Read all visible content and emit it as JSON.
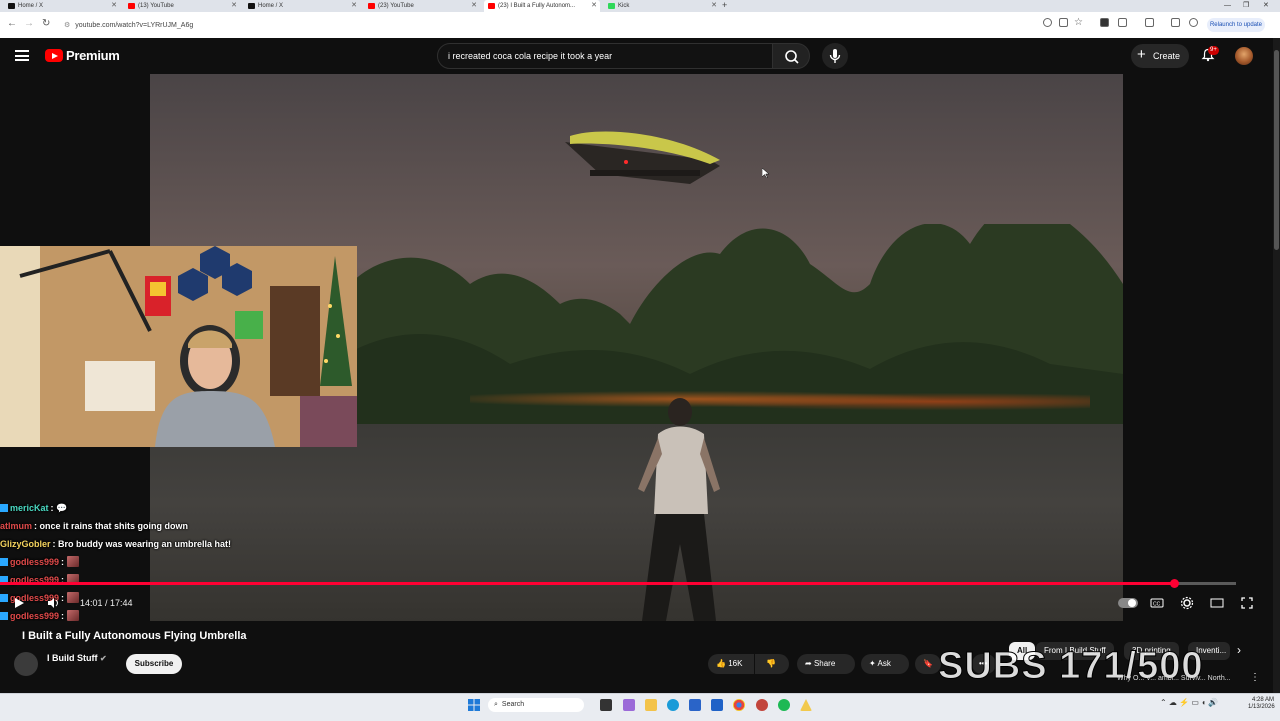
{
  "browser": {
    "tabs": [
      {
        "title": "Home / X",
        "favicon_color": "#111111"
      },
      {
        "title": "(13) YouTube",
        "favicon_color": "#ff0000"
      },
      {
        "title": "Home / X",
        "favicon_color": "#111111"
      },
      {
        "title": "(23) YouTube",
        "favicon_color": "#ff0000"
      },
      {
        "title": "(23) I Built a Fully Autonom...",
        "favicon_color": "#ff0000"
      },
      {
        "title": "Kick",
        "favicon_color": "#2fd85a"
      }
    ],
    "url": "youtube.com/watch?v=LYRrUJM_A6g",
    "relaunch_label": "Relaunch to update"
  },
  "youtube": {
    "logo_text": "Premium",
    "search_value": "i recreated coca cola recipe it took a year",
    "create_label": "Create",
    "notification_badge": "9+"
  },
  "player": {
    "time_current": "14:01",
    "time_total": "17:44",
    "time_display": "14:01 / 17:44",
    "progress_fraction": 0.95
  },
  "chat": [
    {
      "user": "mericKat",
      "text": "",
      "color": "#4ad9c2"
    },
    {
      "user": "atlmum",
      "text": "once it rains that shits going down",
      "color": "#e04a4a"
    },
    {
      "user": "GlizyGobler",
      "text": "Bro buddy was wearing an umbrella hat!",
      "color": "#f4d35e"
    },
    {
      "user": "godless999",
      "text": "",
      "color": "#e04a4a"
    },
    {
      "user": "godless999",
      "text": "",
      "color": "#e04a4a"
    },
    {
      "user": "godless999",
      "text": "",
      "color": "#e04a4a"
    },
    {
      "user": "godless999",
      "text": "",
      "color": "#e04a4a"
    }
  ],
  "video": {
    "title": "I Built a Fully Autonomous Flying Umbrella",
    "channel": "I Build Stuff",
    "subscribe_label": "Subscribe",
    "likes": "16K",
    "share_label": "Share",
    "ask_label": "Ask"
  },
  "recommend_chips": [
    "All",
    "From I Build Stuff",
    "3D printing",
    "Inventi..."
  ],
  "subs_overlay": "SUBS 171/500",
  "up_next_snippet": "Why O... V... ambi... Surviv... North...",
  "taskbar": {
    "search_label": "Search",
    "time": "4:28 AM",
    "date": "1/13/2026"
  }
}
